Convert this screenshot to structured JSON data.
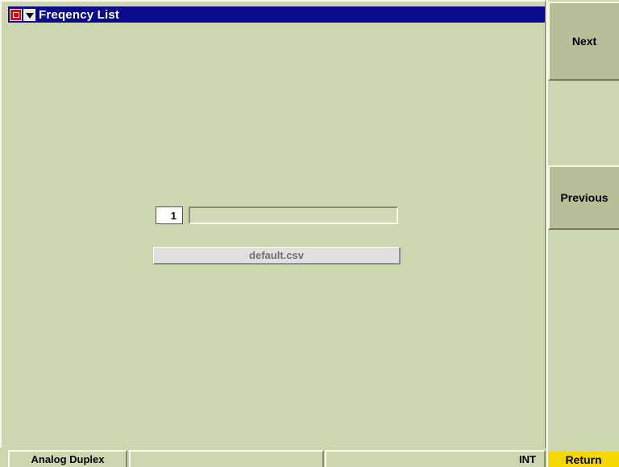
{
  "window": {
    "title": "Freqency List",
    "icons": [
      "system-menu-icon",
      "dropdown-arrow-icon"
    ]
  },
  "softkeys": {
    "next": "Next",
    "previous": "Previous",
    "return": "Return"
  },
  "list": {
    "index": "1",
    "name": "",
    "file": "default.csv"
  },
  "status": {
    "mode": "Analog Duplex",
    "middle": "",
    "reference": "INT"
  },
  "colors": {
    "background": "#cdd6ae",
    "title_bar": "#0a0a8c",
    "return_key": "#f4d800"
  }
}
